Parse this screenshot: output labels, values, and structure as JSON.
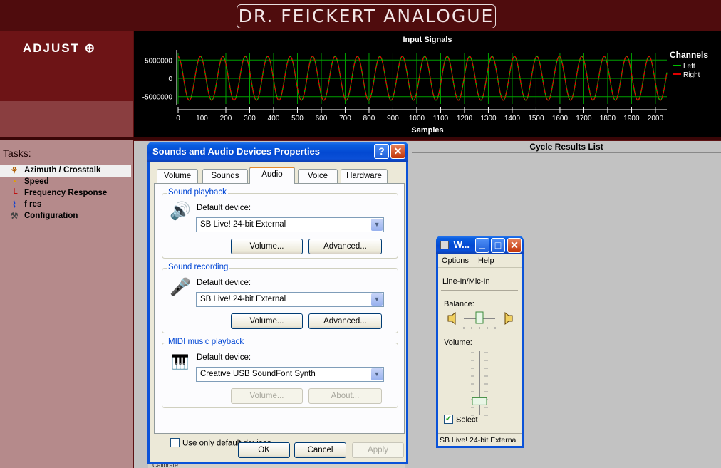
{
  "app": {
    "brand": "DR. FEICKERT ANALOGUE",
    "adjust_label": "ADJUST ⊕",
    "tasks_title": "Tasks:",
    "tasks": [
      {
        "label": "Azimuth / Crosstalk",
        "icon": "azimuth-icon",
        "active": true
      },
      {
        "label": "Speed",
        "icon": "speed-icon",
        "active": false
      },
      {
        "label": "Frequency Response",
        "icon": "frequency-icon",
        "active": false
      },
      {
        "label": "f res",
        "icon": "fres-icon",
        "active": false
      },
      {
        "label": "Configuration",
        "icon": "configuration-icon",
        "active": false
      }
    ],
    "cycle_results_title": "Cycle Results List",
    "bottom_strip_text": "Calibrate"
  },
  "chart_data": {
    "type": "line",
    "title": "Input Signals",
    "xlabel": "Samples",
    "ylabel": "",
    "xlim": [
      0,
      2048
    ],
    "ylim": [
      -7000000,
      7000000
    ],
    "x_ticks": [
      0,
      100,
      200,
      300,
      400,
      500,
      600,
      700,
      800,
      900,
      1000,
      1100,
      1200,
      1300,
      1400,
      1500,
      1600,
      1700,
      1800,
      1900,
      2000
    ],
    "y_ticks": [
      5000000,
      0,
      -5000000
    ],
    "y_tick_labels": [
      "5000000",
      "0",
      "-5000000"
    ],
    "grid": true,
    "legend_title": "Channels",
    "legend_position": "right",
    "series": [
      {
        "name": "Left",
        "color": "#00c000",
        "waveform": "sine",
        "amplitude": 6000000,
        "period_samples": 94
      },
      {
        "name": "Right",
        "color": "#e00000",
        "waveform": "sine",
        "amplitude": 6000000,
        "period_samples": 94
      }
    ],
    "colors": {
      "background": "#000000",
      "grid": "#00a000",
      "axis": "#ffffff",
      "text": "#ffffff"
    }
  },
  "dialog": {
    "title": "Sounds and Audio Devices Properties",
    "help_label": "?",
    "close_label": "✕",
    "tabs": [
      "Volume",
      "Sounds",
      "Audio",
      "Voice",
      "Hardware"
    ],
    "selected_tab": "Audio",
    "playback": {
      "group_label": "Sound playback",
      "default_label": "Default device:",
      "device": "SB Live! 24-bit External",
      "volume_btn": "Volume...",
      "advanced_btn": "Advanced..."
    },
    "recording": {
      "group_label": "Sound recording",
      "default_label": "Default device:",
      "device": "SB Live! 24-bit External",
      "volume_btn": "Volume...",
      "advanced_btn": "Advanced..."
    },
    "midi": {
      "group_label": "MIDI music playback",
      "default_label": "Default device:",
      "device": "Creative USB SoundFont Synth",
      "volume_btn": "Volume...",
      "about_btn": "About..."
    },
    "use_default_label": "Use only default devices",
    "use_default_checked": false,
    "ok": "OK",
    "cancel": "Cancel",
    "apply": "Apply"
  },
  "volume_window": {
    "title": "W...",
    "menu": [
      "Options",
      "Help"
    ],
    "line_in": "Line-In/Mic-In",
    "balance_label": "Balance:",
    "balance_value": 0.5,
    "volume_label": "Volume:",
    "volume_value": 0.2,
    "select_label": "Select",
    "select_checked": true,
    "status": "SB Live! 24-bit External"
  }
}
